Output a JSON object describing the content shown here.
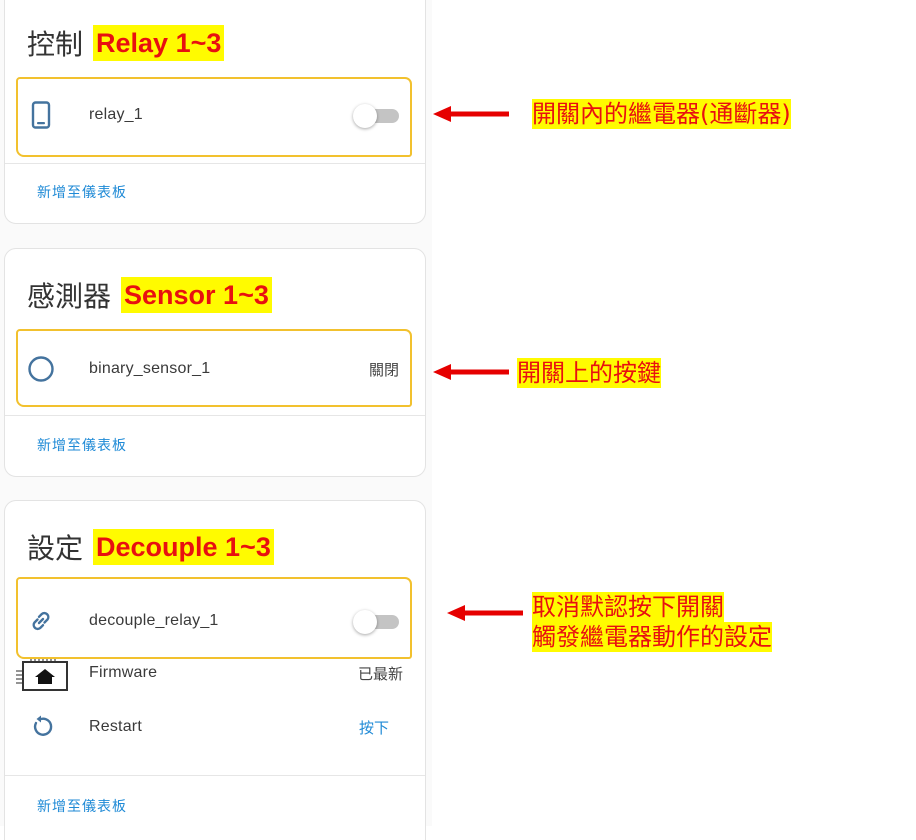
{
  "cards": {
    "control": {
      "title": "控制",
      "highlight": "Relay 1~3",
      "entity_label": "relay_1",
      "add_link": "新增至儀表板"
    },
    "sensor": {
      "title": "感測器",
      "highlight": "Sensor 1~3",
      "entity_label": "binary_sensor_1",
      "entity_state": "關閉",
      "add_link": "新增至儀表板"
    },
    "config": {
      "title": "設定",
      "highlight": "Decouple 1~3",
      "rows": [
        {
          "label": "decouple_relay_1"
        },
        {
          "label": "Firmware",
          "state": "已最新"
        },
        {
          "label": "Restart",
          "action": "按下"
        }
      ],
      "add_link": "新增至儀表板"
    }
  },
  "annotations": {
    "relay": "開關內的繼電器(通斷器)",
    "sensor": "開關上的按鍵",
    "decouple_line1": "取消默認按下開關",
    "decouple_line2": "觸發繼電器動作的設定"
  },
  "icons": {
    "relay_row": "cellphone-icon",
    "sensor_row": "circle-outline-icon",
    "decouple_row": "link-icon",
    "firmware_row": "chip-home-icon",
    "restart_row": "restart-icon",
    "annotation_arrow": "arrow-left-icon"
  },
  "colors": {
    "accent": "#1f8ad6",
    "icon": "#44739e",
    "highlight_bg": "#fffb00",
    "highlight_text": "#e81010",
    "sketch_border": "#f2c12e",
    "arrow": "#e60000"
  }
}
